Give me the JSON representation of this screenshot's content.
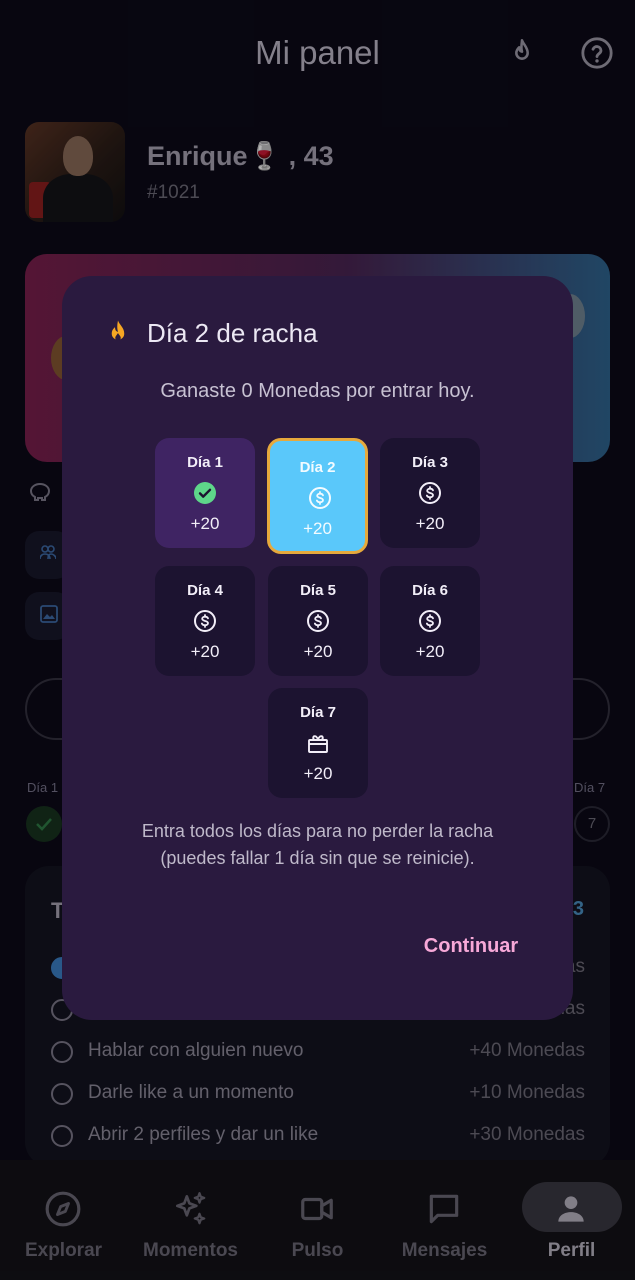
{
  "header": {
    "title": "Mi panel"
  },
  "profile": {
    "name": "Enrique🍷 , 43",
    "id": "#1021"
  },
  "streak_bar": {
    "first_label": "Día 1",
    "last_label": "Día 7",
    "last_number": "7"
  },
  "tasks": {
    "title": "T",
    "count": "3",
    "items": [
      {
        "label": "",
        "reward": "…nas",
        "done": true
      },
      {
        "label": "",
        "reward": "…edas",
        "done": false
      },
      {
        "label": "Hablar con alguien nuevo",
        "reward": "+40 Monedas",
        "done": false
      },
      {
        "label": "Darle like a un momento",
        "reward": "+10 Monedas",
        "done": false
      },
      {
        "label": "Abrir 2 perfiles y dar un like",
        "reward": "+30 Monedas",
        "done": false
      }
    ]
  },
  "nav": {
    "items": [
      {
        "label": "Explorar",
        "icon": "compass-icon"
      },
      {
        "label": "Momentos",
        "icon": "sparkles-icon"
      },
      {
        "label": "Pulso",
        "icon": "video-icon"
      },
      {
        "label": "Mensajes",
        "icon": "chat-icon"
      },
      {
        "label": "Perfil",
        "icon": "person-icon",
        "active": true
      }
    ]
  },
  "dialog": {
    "title": "Día 2 de racha",
    "subtitle": "Ganaste 0 Monedas por entrar hoy.",
    "days": [
      {
        "label": "Día 1",
        "reward": "+20",
        "state": "done",
        "icon": "check-icon"
      },
      {
        "label": "Día 2",
        "reward": "+20",
        "state": "today",
        "icon": "coin-icon"
      },
      {
        "label": "Día 3",
        "reward": "+20",
        "state": "pending",
        "icon": "coin-icon"
      },
      {
        "label": "Día 4",
        "reward": "+20",
        "state": "pending",
        "icon": "coin-icon"
      },
      {
        "label": "Día 5",
        "reward": "+20",
        "state": "pending",
        "icon": "coin-icon"
      },
      {
        "label": "Día 6",
        "reward": "+20",
        "state": "pending",
        "icon": "coin-icon"
      },
      {
        "label": "Día 7",
        "reward": "+20",
        "state": "pending",
        "icon": "gift-icon"
      }
    ],
    "info_line1": "Entra todos los días para no perder la racha",
    "info_line2": "(puedes fallar 1 día sin que se reinicie).",
    "continue_label": "Continuar"
  },
  "colors": {
    "dialog_bg": "#2a1a3f",
    "today_bg": "#5ac8fa",
    "today_border": "#e6a93c",
    "done_bg": "#3f2463",
    "check": "#5ed68a",
    "continue": "#f7a8d8",
    "fire": "#f5a623"
  }
}
